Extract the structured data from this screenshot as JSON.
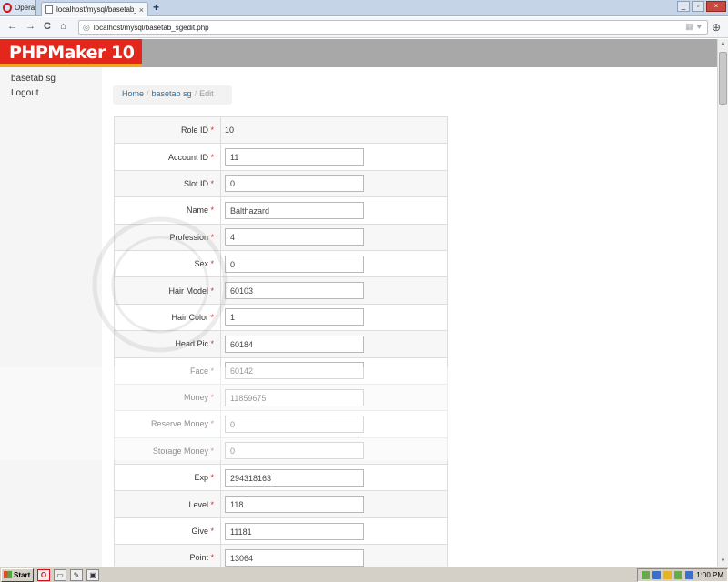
{
  "browser": {
    "menu_label": "Opera",
    "tab_title": "localhost/mysql/basetab_...",
    "tab_close": "×",
    "new_tab": "+",
    "url": "localhost/mysql/basetab_sgedit.php",
    "back": "←",
    "forward": "→",
    "reload": "C",
    "home": "⌂"
  },
  "app": {
    "brand": "PHPMaker 10"
  },
  "sidebar": {
    "items": [
      {
        "label": "basetab sg"
      },
      {
        "label": "Logout"
      }
    ]
  },
  "breadcrumb": {
    "home": "Home",
    "table": "basetab sg",
    "current": "Edit",
    "separator": "/"
  },
  "form": {
    "required_mark": "*",
    "fields": [
      {
        "label": "Role ID",
        "value": "10",
        "readonly": true
      },
      {
        "label": "Account ID",
        "value": "11"
      },
      {
        "label": "Slot ID",
        "value": "0"
      },
      {
        "label": "Name",
        "value": "Balthazard"
      },
      {
        "label": "Profession",
        "value": "4"
      },
      {
        "label": "Sex",
        "value": "0"
      },
      {
        "label": "Hair Model",
        "value": "60103"
      },
      {
        "label": "Hair Color",
        "value": "1"
      },
      {
        "label": "Head Pic",
        "value": "60184"
      },
      {
        "label": "Face",
        "value": "60142"
      },
      {
        "label": "Money",
        "value": "11859675"
      },
      {
        "label": "Reserve Money",
        "value": "0"
      },
      {
        "label": "Storage Money",
        "value": "0"
      },
      {
        "label": "Exp",
        "value": "294318163"
      },
      {
        "label": "Level",
        "value": "118"
      },
      {
        "label": "Give",
        "value": "11181"
      },
      {
        "label": "Point",
        "value": "13064"
      }
    ]
  },
  "taskbar": {
    "start_label": "Start",
    "clock": "1:00 PM"
  },
  "colors": {
    "brand_red": "#e3271c",
    "brand_orange": "#f6a21c",
    "header_gray": "#a8a8a8",
    "link_blue": "#2a6fa8",
    "required_red": "#c9302c"
  }
}
